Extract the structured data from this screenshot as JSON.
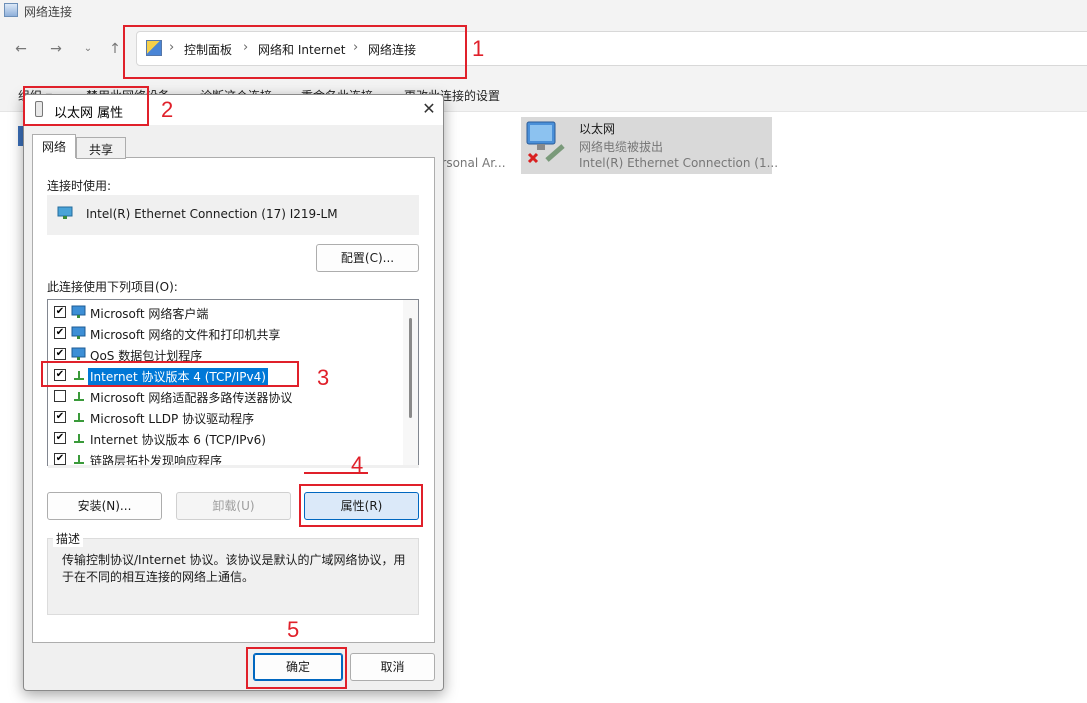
{
  "window": {
    "title": "网络连接"
  },
  "breadcrumb": [
    "控制面板",
    "网络和 Internet",
    "网络连接"
  ],
  "command_bar": [
    "组织 ▾",
    "禁用此网络设备",
    "诊断这个连接",
    "重命名此连接",
    "更改此连接的设置"
  ],
  "adapters": {
    "ethernet": {
      "name": "以太网",
      "status": "网络电缆被拔出",
      "device": "Intel(R) Ethernet Connection (1..."
    },
    "other_partial_text": "ersonal Ar..."
  },
  "dialog": {
    "title": "以太网 属性",
    "close": "✕",
    "tabs": [
      "网络",
      "共享"
    ],
    "connect_using_label": "连接时使用:",
    "device_name": "Intel(R) Ethernet Connection (17) I219-LM",
    "configure_button": "配置(C)...",
    "items_label": "此连接使用下列项目(O):",
    "items": [
      {
        "label": "Microsoft 网络客户端",
        "checked": "✔",
        "icon": "network-client-icon"
      },
      {
        "label": "Microsoft 网络的文件和打印机共享",
        "checked": "✔",
        "icon": "file-share-icon"
      },
      {
        "label": "QoS 数据包计划程序",
        "checked": "✔",
        "icon": "qos-icon"
      },
      {
        "label": "Internet 协议版本 4 (TCP/IPv4)",
        "checked": "✔",
        "icon": "protocol-icon"
      },
      {
        "label": "Microsoft 网络适配器多路传送器协议",
        "checked": "",
        "icon": "protocol-icon"
      },
      {
        "label": "Microsoft LLDP 协议驱动程序",
        "checked": "✔",
        "icon": "protocol-icon"
      },
      {
        "label": "Internet 协议版本 6 (TCP/IPv6)",
        "checked": "✔",
        "icon": "protocol-icon"
      },
      {
        "label": "链路层拓扑发现响应程序",
        "checked": "✔",
        "icon": "protocol-icon"
      }
    ],
    "install_button": "安装(N)...",
    "uninstall_button": "卸载(U)",
    "properties_button": "属性(R)",
    "description_title": "描述",
    "description": "传输控制协议/Internet 协议。该协议是默认的广域网络协议，用于在不同的相互连接的网络上通信。",
    "ok_button": "确定",
    "cancel_button": "取消"
  },
  "annotations": [
    "1",
    "2",
    "3",
    "4",
    "5"
  ],
  "colors": {
    "annotation": "#e0202a",
    "selection": "#0078d7",
    "primary_border": "#0067c0"
  }
}
